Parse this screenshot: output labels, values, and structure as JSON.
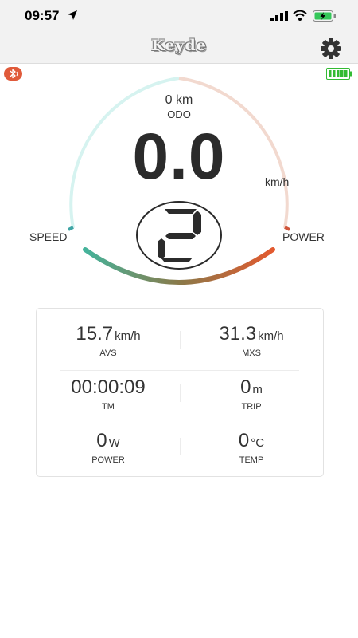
{
  "status_bar": {
    "time": "09:57"
  },
  "header": {
    "title": "Keyde"
  },
  "gauge": {
    "odo_value": "0 km",
    "odo_label": "ODO",
    "speed": "0.0",
    "speed_unit": "km/h",
    "left_label": "SPEED",
    "right_label": "POWER",
    "gear_level": "2"
  },
  "stats": {
    "avs": {
      "value": "15.7",
      "unit": "km/h",
      "label": "AVS"
    },
    "mxs": {
      "value": "31.3",
      "unit": "km/h",
      "label": "MXS"
    },
    "tm": {
      "value": "00:00:09",
      "unit": "",
      "label": "TM"
    },
    "trip": {
      "value": "0",
      "unit": "m",
      "label": "TRIP"
    },
    "power": {
      "value": "0",
      "unit": "W",
      "label": "POWER"
    },
    "temp": {
      "value": "0",
      "unit": "°C",
      "label": "TEMP"
    }
  },
  "colors": {
    "speed_arc_track": "#d6f3f0",
    "power_arc_track": "#f2d9cf",
    "gradient_start": "#45b39b",
    "gradient_end": "#e35a2f",
    "device_battery": "#33bb33"
  }
}
